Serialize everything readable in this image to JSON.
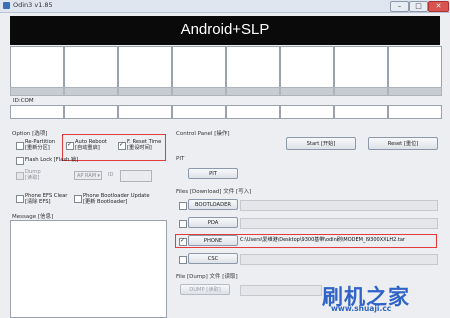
{
  "window": {
    "title": "Odin3 v1.85",
    "minimize": "–",
    "maximize": "□",
    "close": "✕",
    "banner": "Android+SLP"
  },
  "ports": {
    "id_com_label": "ID:COM"
  },
  "options": {
    "group_label": "Option [选项]",
    "re_partition": {
      "line1": "Re-Partition",
      "line2": "[重新分区]",
      "checked": false
    },
    "auto_reboot": {
      "line1": "Auto Reboot",
      "line2": "[自动重启]",
      "checked": true
    },
    "f_reset_time": {
      "line1": "F. Reset Time",
      "line2": "[重设时间]",
      "checked": true
    },
    "flash_lock": {
      "label": "Flash Lock [Flash 锁]",
      "checked": false
    },
    "dump": {
      "line1": "Dump",
      "line2": "[读取]",
      "checked": false,
      "select_value": "AP RAM",
      "id_label": "ID"
    },
    "phone_efs_clear": {
      "line1": "Phone EFS Clear",
      "line2": "[清除 EFS]",
      "checked": false
    },
    "phone_bootloader_update": {
      "line1": "Phone Bootloader Update",
      "line2": "[更新 Bootloader]",
      "checked": false
    }
  },
  "message": {
    "label": "Message [信息]"
  },
  "control_panel": {
    "label": "Control Panel [操作]",
    "start": "Start [开始]",
    "reset": "Reset [重位]"
  },
  "pit": {
    "label": "PIT",
    "button": "PIT"
  },
  "files": {
    "label": "Files [Download] 文件 [写入]",
    "rows": [
      {
        "button": "BOOTLOADER",
        "checked": false,
        "path": ""
      },
      {
        "button": "PDA",
        "checked": false,
        "path": ""
      },
      {
        "button": "PHONE",
        "checked": true,
        "path": "C:\\Users\\爱维港\\Desktop\\9300基带\\odin刷\\MODEM_I9300XXLH2.tar"
      },
      {
        "button": "CSC",
        "checked": false,
        "path": ""
      }
    ]
  },
  "dump_file": {
    "label": "File [Dump] 文件 [读取]",
    "button": "DUMP [读取]"
  },
  "watermark": {
    "cn": "刷机之家",
    "url": "www.shuaji.cc"
  }
}
